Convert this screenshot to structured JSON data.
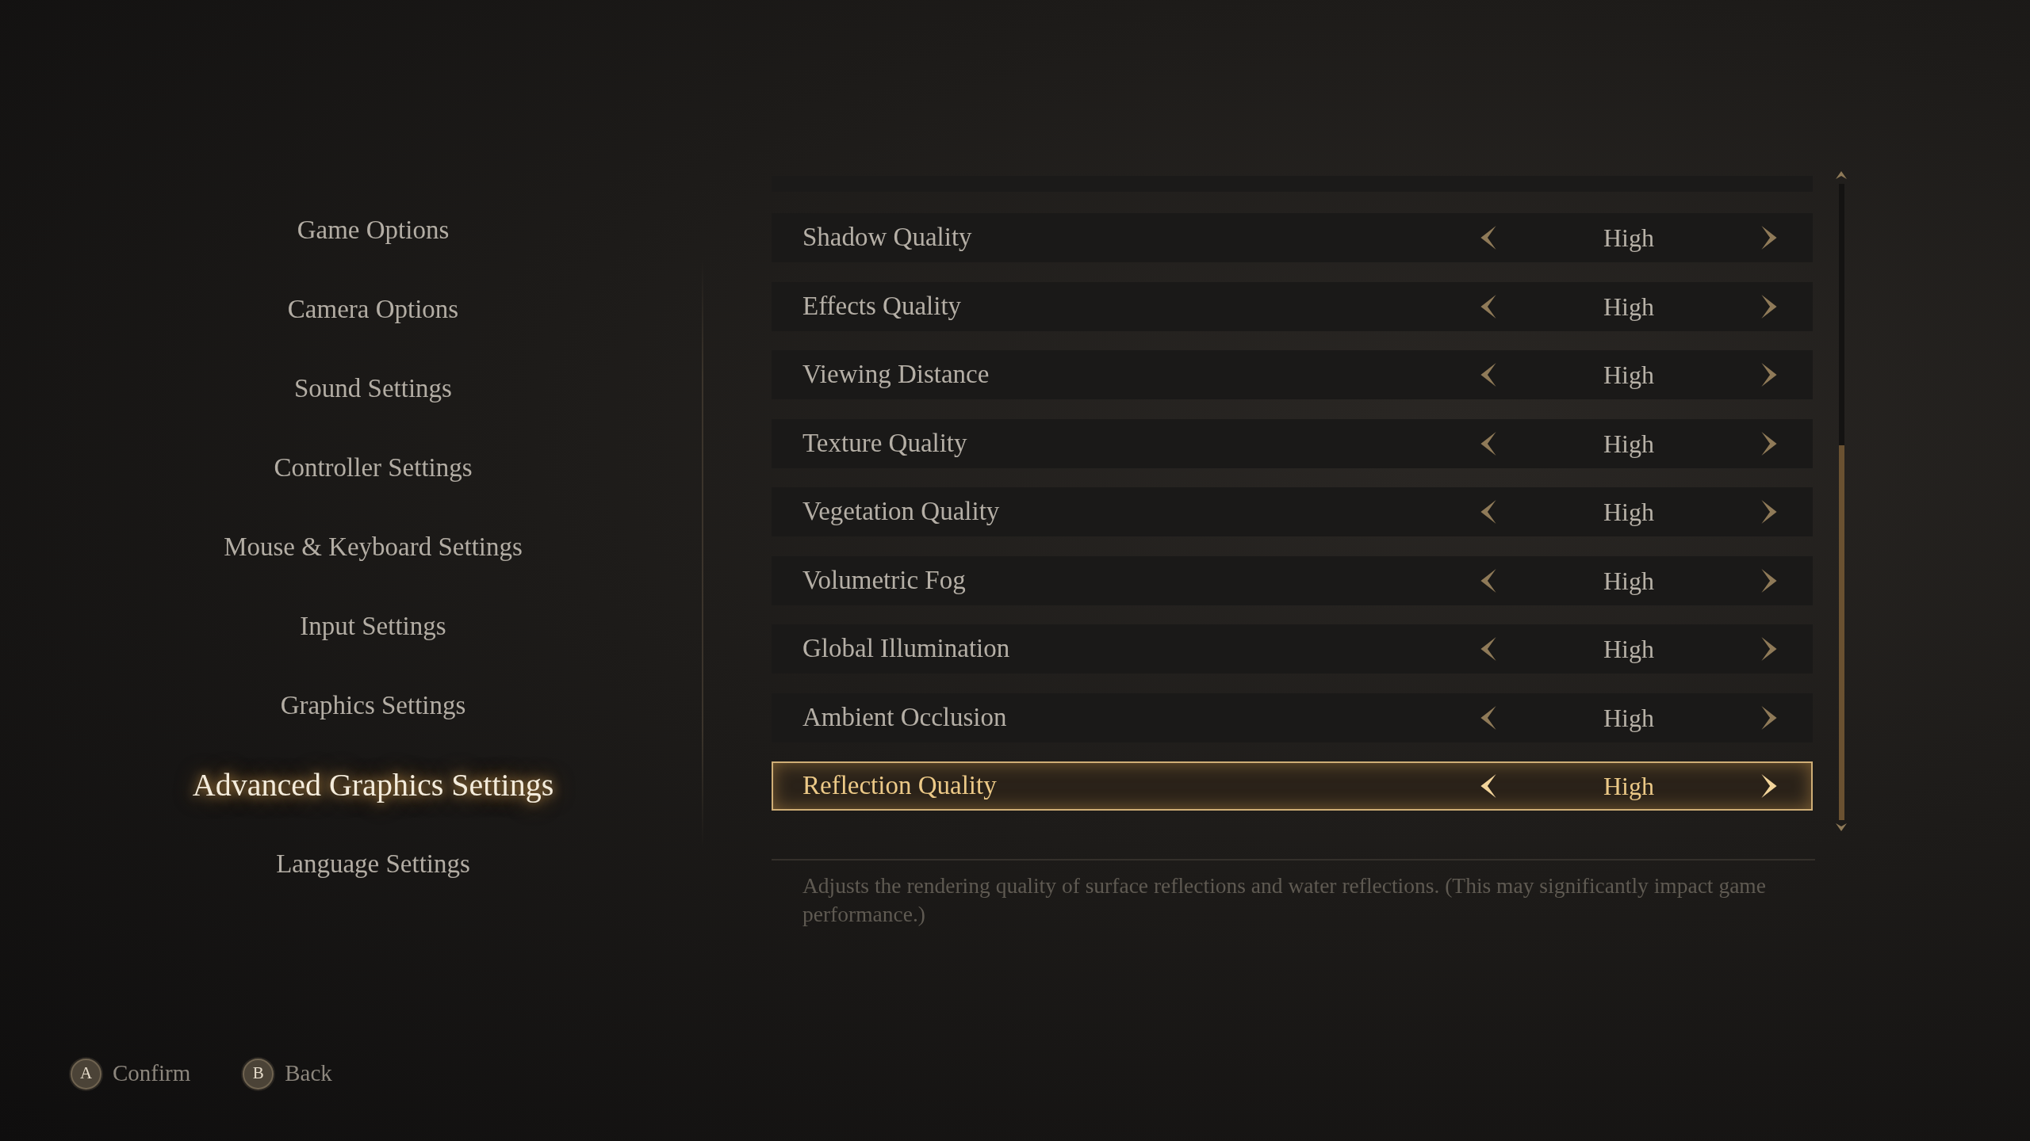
{
  "menu": {
    "items": [
      {
        "label": "Game Options",
        "selected": false
      },
      {
        "label": "Camera Options",
        "selected": false
      },
      {
        "label": "Sound Settings",
        "selected": false
      },
      {
        "label": "Controller Settings",
        "selected": false
      },
      {
        "label": "Mouse & Keyboard Settings",
        "selected": false
      },
      {
        "label": "Input Settings",
        "selected": false
      },
      {
        "label": "Graphics Settings",
        "selected": false
      },
      {
        "label": "Advanced Graphics Settings",
        "selected": true
      },
      {
        "label": "Language Settings",
        "selected": false
      }
    ]
  },
  "settings": {
    "rows": [
      {
        "label": "Shadow Quality",
        "value": "High",
        "selected": false
      },
      {
        "label": "Effects Quality",
        "value": "High",
        "selected": false
      },
      {
        "label": "Viewing Distance",
        "value": "High",
        "selected": false
      },
      {
        "label": "Texture Quality",
        "value": "High",
        "selected": false
      },
      {
        "label": "Vegetation Quality",
        "value": "High",
        "selected": false
      },
      {
        "label": "Volumetric Fog",
        "value": "High",
        "selected": false
      },
      {
        "label": "Global Illumination",
        "value": "High",
        "selected": false
      },
      {
        "label": "Ambient Occlusion",
        "value": "High",
        "selected": false
      },
      {
        "label": "Reflection Quality",
        "value": "High",
        "selected": true
      }
    ],
    "description": "Adjusts the rendering quality of surface reflections and water reflections. (This may significantly impact game performance.)"
  },
  "footer": {
    "prompts": [
      {
        "key": "A",
        "label": "Confirm"
      },
      {
        "key": "B",
        "label": "Back"
      }
    ]
  }
}
